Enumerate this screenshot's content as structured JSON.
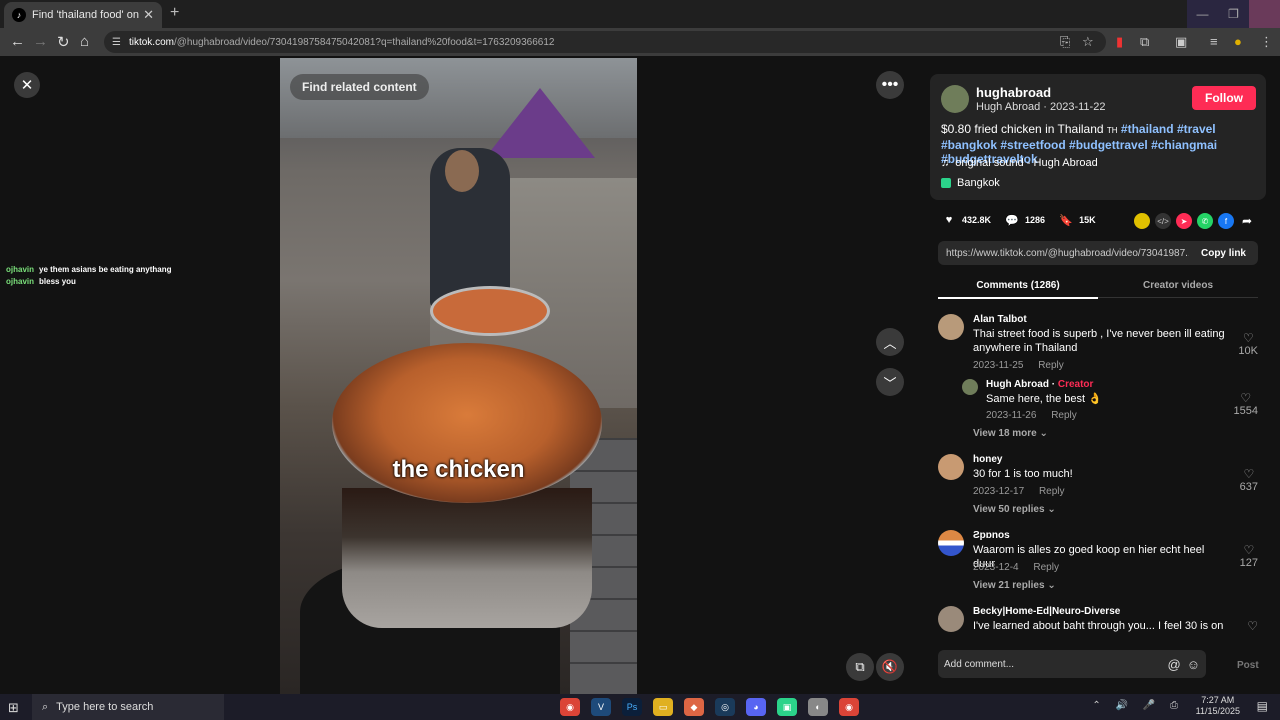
{
  "browser": {
    "tab_title": "Find 'thailand food' on TikTok |",
    "tab_close": "✕",
    "new_tab": "+",
    "url_domain": "tiktok.com",
    "url_path": "/@hughabroad/video/7304198758475042081?q=thailand%20food&t=1763209366612",
    "win_min": "—",
    "win_max": "❐",
    "win_close": ""
  },
  "overlay_chat": [
    {
      "user": "ojhavin",
      "text": "ye them asians be eating anythang"
    },
    {
      "user": "ojhavin",
      "text": "bless you"
    }
  ],
  "video": {
    "find_related": "Find related content",
    "caption": "the chicken"
  },
  "author": {
    "username": "hughabroad",
    "display_and_date": "Hugh Abroad · 2023-11-22",
    "follow_label": "Follow",
    "desc_text": "$0.80 fried chicken in Thailand ",
    "flag": "TH",
    "hashtags": [
      "#thailand",
      "#travel",
      "#bangkok",
      "#streetfood",
      "#budgettravel",
      "#chiangmai",
      "#budgettraveltok"
    ],
    "sound": "original sound - Hugh Abroad",
    "location": "Bangkok"
  },
  "stats": {
    "likes": "432.8K",
    "comments": "1286",
    "saves": "15K"
  },
  "link": {
    "url": "https://www.tiktok.com/@hughabroad/video/73041987...",
    "copy_label": "Copy link"
  },
  "tabs": {
    "comments": "Comments (1286)",
    "creator": "Creator videos"
  },
  "comments": [
    {
      "name": "Alan Talbot",
      "text": "Thai street food is superb , I've never been ill eating anywhere in Thailand",
      "date": "2023-11-25",
      "reply": "Reply",
      "likes": "10K"
    },
    {
      "name": "Hugh Abroad",
      "creator": "Creator",
      "text": "Same here, the best 👌",
      "date": "2023-11-26",
      "reply": "Reply",
      "likes": "1554"
    },
    {
      "name": "honey",
      "text": "30 for 1 is too much!",
      "date": "2023-12-17",
      "reply": "Reply",
      "likes": "637"
    },
    {
      "name": "Ƨpɒnos",
      "text": "Waarom is alles zo goed koop en hier echt heel duur",
      "date": "2023-12-4",
      "reply": "Reply",
      "likes": "127"
    },
    {
      "name": "Becky|Home-Ed|Neuro-Diverse",
      "text": "I've learned about baht through you... I feel 30 is on"
    }
  ],
  "view_more": {
    "c1": "View 18 more",
    "c2": "View 50 replies",
    "c3": "View 21 replies"
  },
  "compose": {
    "placeholder": "Add comment...",
    "post_label": "Post"
  },
  "taskbar": {
    "search_placeholder": "Type here to search",
    "time": "7:27 AM",
    "date": "11/15/2025"
  }
}
